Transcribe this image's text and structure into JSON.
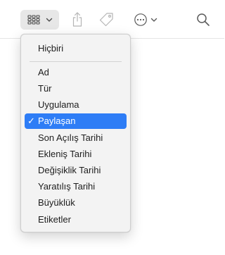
{
  "toolbar": {
    "group_button": {
      "icon": "grid-icon",
      "chevron": "chevron-down-icon"
    },
    "share_button": {
      "icon": "share-icon"
    },
    "tag_button": {
      "icon": "tag-icon"
    },
    "action_button": {
      "icon": "ellipsis-circle-icon",
      "chevron": "chevron-down-icon"
    },
    "search_button": {
      "icon": "search-icon"
    }
  },
  "menu": {
    "none_item": "Hiçbiri",
    "items": [
      {
        "label": "Ad",
        "selected": false
      },
      {
        "label": "Tür",
        "selected": false
      },
      {
        "label": "Uygulama",
        "selected": false
      },
      {
        "label": "Paylaşan",
        "selected": true
      },
      {
        "label": "Son Açılış Tarihi",
        "selected": false
      },
      {
        "label": "Ekleniş Tarihi",
        "selected": false
      },
      {
        "label": "Değişiklik Tarihi",
        "selected": false
      },
      {
        "label": "Yaratılış Tarihi",
        "selected": false
      },
      {
        "label": "Büyüklük",
        "selected": false
      },
      {
        "label": "Etiketler",
        "selected": false
      }
    ],
    "check_mark": "✓"
  },
  "colors": {
    "accent": "#2e7df6",
    "icon": "#5a5a5a",
    "icon_disabled": "#b5b5b5"
  }
}
